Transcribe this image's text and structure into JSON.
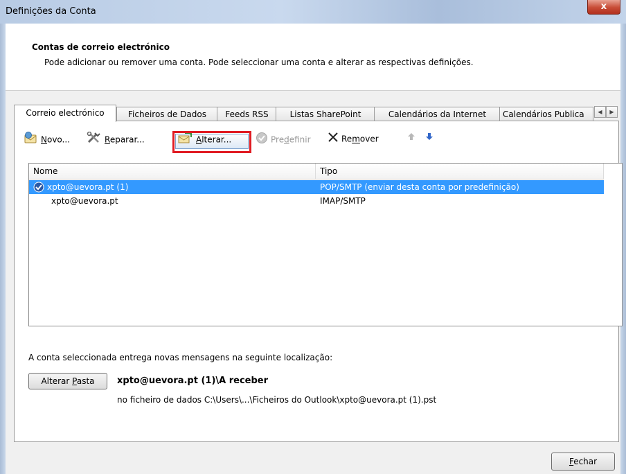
{
  "window": {
    "title": "Definições da Conta",
    "close_glyph": "x"
  },
  "header": {
    "heading": "Contas de correio electrónico",
    "description": "Pode adicionar ou remover uma conta. Pode seleccionar uma conta e alterar as respectivas definições."
  },
  "tabs": [
    {
      "label": "Correio electrónico",
      "active": true
    },
    {
      "label": "Ficheiros de Dados",
      "active": false
    },
    {
      "label": "Feeds RSS",
      "active": false
    },
    {
      "label": "Listas SharePoint",
      "active": false
    },
    {
      "label": "Calendários da Internet",
      "active": false
    },
    {
      "label": "Calendários Publica",
      "active": false
    }
  ],
  "toolbar": {
    "new": {
      "prefix": "",
      "ul": "N",
      "suffix": "ovo...",
      "icon": "new-account-icon"
    },
    "repair": {
      "prefix": "",
      "ul": "R",
      "suffix": "eparar...",
      "icon": "repair-tools-icon"
    },
    "change": {
      "prefix": "",
      "ul": "A",
      "suffix": "lterar...",
      "icon": "change-account-icon"
    },
    "default": {
      "prefix": "Pre",
      "ul": "d",
      "suffix": "efinir",
      "icon": "checkmark-circle-icon",
      "enabled": false
    },
    "remove": {
      "prefix": "Re",
      "ul": "m",
      "suffix": "over",
      "icon": "x-icon"
    },
    "move_up_icon": "arrow-up-icon",
    "move_down_icon": "arrow-down-icon",
    "highlight_color": "#e01b22"
  },
  "accounts": {
    "columns": [
      "Nome",
      "Tipo"
    ],
    "rows": [
      {
        "name": "xpto@uevora.pt (1)",
        "type": "POP/SMTP (enviar desta conta por predefinição)",
        "selected": true,
        "default": true
      },
      {
        "name": "xpto@uevora.pt",
        "type": "IMAP/SMTP",
        "selected": false,
        "default": false
      }
    ],
    "selection_color": "#3399ff"
  },
  "delivery": {
    "label": "A conta seleccionada entrega novas mensagens na seguinte localização:",
    "change_folder": {
      "prefix": "Alterar ",
      "ul": "P",
      "suffix": "asta"
    },
    "folder": "xpto@uevora.pt (1)\\A receber",
    "data_file": "no ficheiro de dados C:\\Users\\...\\Ficheiros do Outlook\\xpto@uevora.pt (1).pst"
  },
  "footer": {
    "close": {
      "prefix": "",
      "ul": "F",
      "suffix": "echar"
    }
  }
}
